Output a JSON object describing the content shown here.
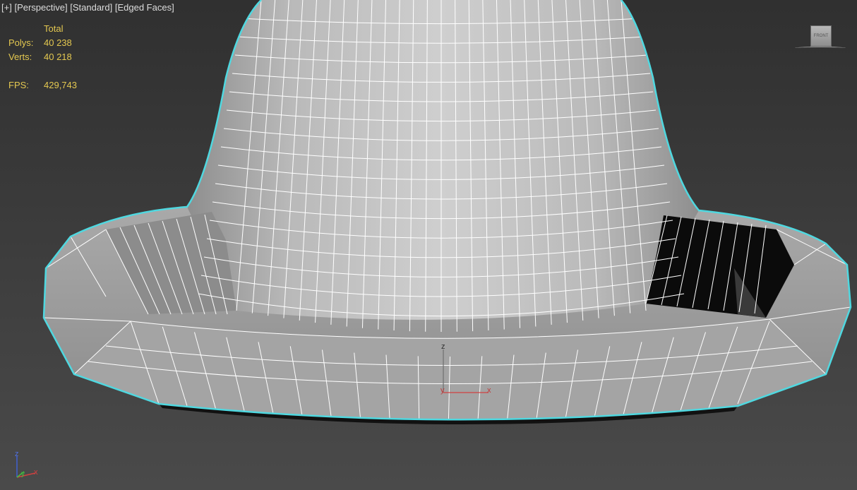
{
  "viewport": {
    "label_plus": "[+]",
    "label_view": "[Perspective]",
    "label_shading": "[Standard]",
    "label_edges": "[Edged Faces]"
  },
  "stats": {
    "header": "Total",
    "polys_label": "Polys:",
    "polys_value": "40 238",
    "verts_label": "Verts:",
    "verts_value": "40 218",
    "fps_label": "FPS:",
    "fps_value": "429,743"
  },
  "viewcube": {
    "face": "FRONT"
  },
  "gizmo": {
    "z": "z",
    "x": "x",
    "y": "y"
  },
  "corner_axis": {
    "z": "z",
    "x": "x",
    "y": "y"
  },
  "colors": {
    "selection_outline": "#4fd8e0",
    "mesh_light": "#c8c8c8",
    "mesh_dark": "#8a8a8a",
    "wire": "#ffffff",
    "stats_text": "#e4c850",
    "axis_x": "#d04040",
    "axis_y": "#40c040",
    "axis_z": "#4060d0"
  }
}
